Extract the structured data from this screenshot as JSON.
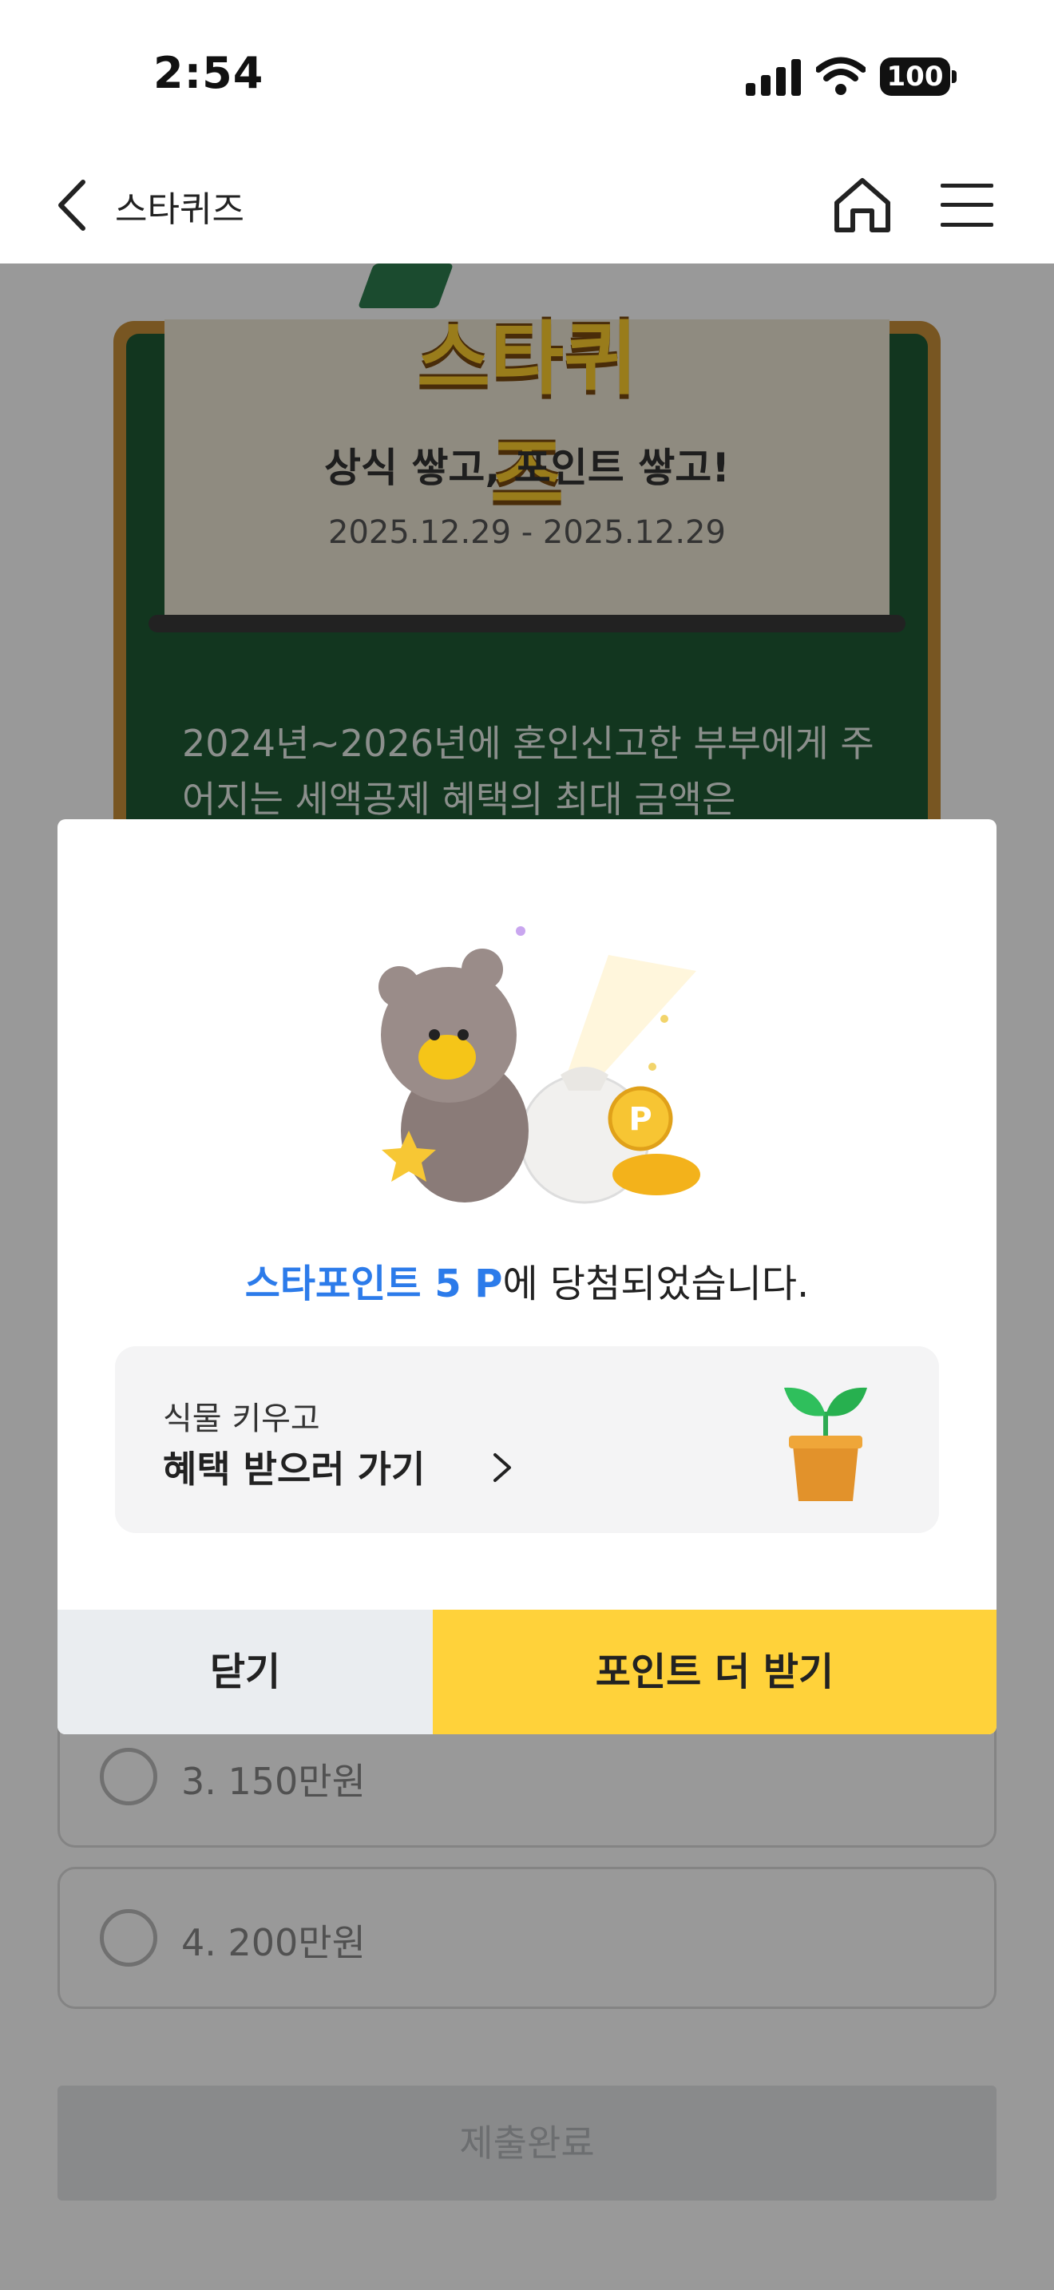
{
  "status_bar": {
    "time": "2:54",
    "battery": "100"
  },
  "nav": {
    "title": "스타퀴즈"
  },
  "quiz": {
    "logo_text": "스타퀴즈",
    "headline": "상식 쌓고, 포인트 쌓고!",
    "dates": "2025.12.29 - 2025.12.29",
    "question": "2024년~2026년에 혼인신고한 부부에게 주어지는 세액공제 혜택의 최대 금액은",
    "options": [
      "3. 150만원",
      "4. 200만원"
    ],
    "submit_label": "제출완료"
  },
  "modal": {
    "win_highlight": "스타포인트 5 P",
    "win_rest": "에 당첨되었습니다.",
    "benefit_sub": "식물 키우고",
    "benefit_main": "혜택 받으러 가기",
    "close_label": "닫기",
    "more_label": "포인트 더 받기",
    "accent_color": "#2c7bea",
    "primary_button_color": "#ffd23a"
  },
  "icons": [
    "signal-icon",
    "wifi-icon",
    "battery-icon",
    "back-icon",
    "home-icon",
    "menu-icon",
    "chevron-right-icon",
    "plant-icon",
    "bear-illustration"
  ]
}
